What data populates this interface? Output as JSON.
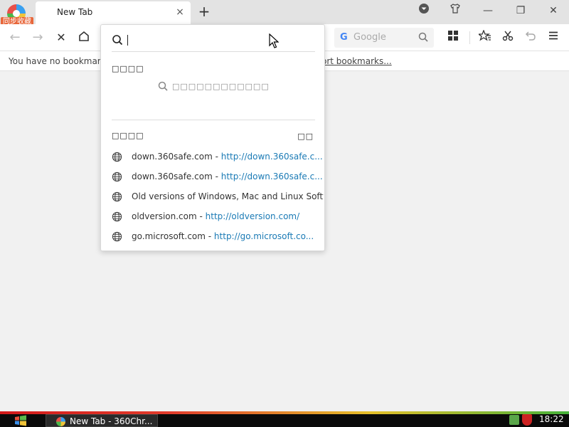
{
  "titlebar": {
    "sync_badge": "同步收藏",
    "tab_title": "New Tab",
    "tab_close": "×",
    "new_tab": "+",
    "minimize": "—",
    "restore": "❐",
    "close": "✕"
  },
  "toolbar": {
    "back": "←",
    "forward": "→",
    "stop": "✕",
    "search_engine_letter": "G",
    "search_placeholder": "Google"
  },
  "bookmarks_bar": {
    "empty_text": "You have no bookmarks",
    "import_link": "ort bookmarks..."
  },
  "dropdown": {
    "input_value": "",
    "section1_label": "□□□□",
    "empty_message": "□□□□□□□□□□□□",
    "section2_label": "□□□□",
    "section2_action": "□□",
    "items": [
      {
        "domain": "down.360safe.com",
        "sep": " - ",
        "url": "http://down.360safe.c..."
      },
      {
        "domain": "down.360safe.com",
        "sep": " - ",
        "url": "http://down.360safe.c..."
      },
      {
        "domain": "Old versions of Windows, Mac and Linux Softw",
        "sep": "",
        "url": ""
      },
      {
        "domain": "oldversion.com",
        "sep": " - ",
        "url": "http://oldversion.com/"
      },
      {
        "domain": "go.microsoft.com",
        "sep": " - ",
        "url": "http://go.microsoft.co..."
      }
    ]
  },
  "taskbar": {
    "task_label": "New Tab - 360Chr...",
    "clock": "18:22"
  },
  "colors": {
    "url_link": "#1a7ab5",
    "sync_badge": "#e8673b"
  }
}
